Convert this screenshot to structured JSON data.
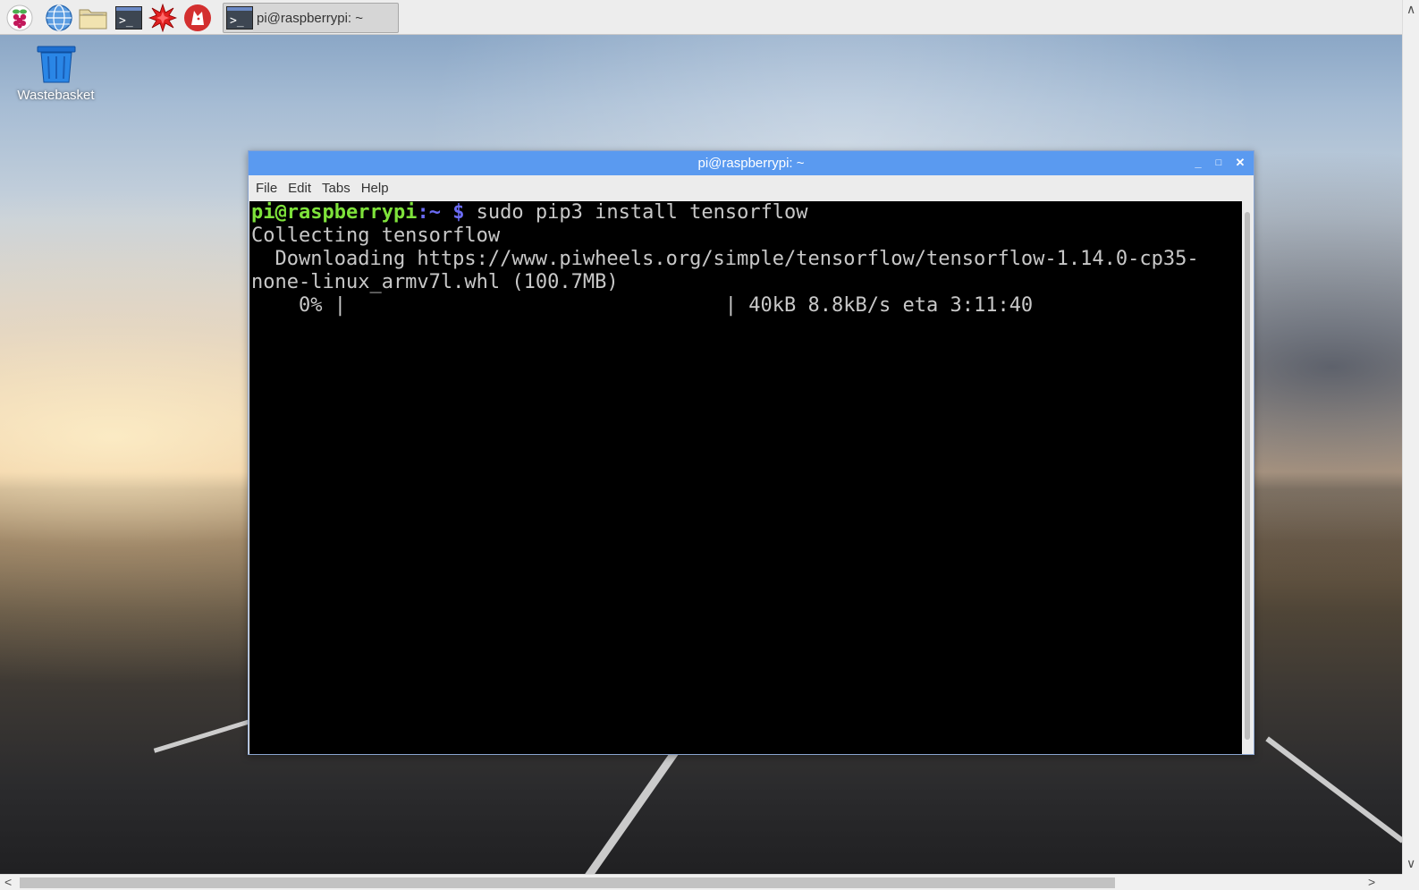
{
  "panel": {
    "launchers": [
      {
        "name": "raspberry-menu",
        "icon": "raspberry-icon"
      },
      {
        "name": "web-browser",
        "icon": "globe-icon"
      },
      {
        "name": "file-manager",
        "icon": "folder-icon"
      },
      {
        "name": "terminal",
        "icon": "terminal-icon"
      },
      {
        "name": "mathematica",
        "icon": "mathematica-icon"
      },
      {
        "name": "wolfram",
        "icon": "wolf-icon"
      }
    ],
    "task": {
      "label": "pi@raspberrypi: ~",
      "icon": "terminal-icon"
    },
    "terminal_glyph": ">_"
  },
  "desktop": {
    "wastebasket_label": "Wastebasket"
  },
  "window": {
    "title": "pi@raspberrypi: ~",
    "controls": {
      "minimize": "_",
      "maximize": "□",
      "close": "✕"
    },
    "menu": [
      {
        "label": "File"
      },
      {
        "label": "Edit"
      },
      {
        "label": "Tabs"
      },
      {
        "label": "Help"
      }
    ],
    "terminal": {
      "prompt_user": "pi@raspberrypi",
      "prompt_sep": ":",
      "prompt_path": "~",
      "prompt_dollar": "$",
      "command": " sudo pip3 install tensorflow",
      "lines": [
        "Collecting tensorflow",
        "  Downloading https://www.piwheels.org/simple/tensorflow/tensorflow-1.14.0-cp35-",
        "none-linux_armv7l.whl (100.7MB)",
        "    0% |                                | 40kB 8.8kB/s eta 3:11:40"
      ]
    }
  },
  "colors": {
    "titlebar": "#5a9af0",
    "prompt_user": "#7ee23a",
    "prompt_path": "#6b6bf5",
    "terminal_bg": "#000000",
    "terminal_fg": "#c8c8c8"
  },
  "scroll_arrows": {
    "up": "∧",
    "down": "∨",
    "left": "<",
    "right": ">"
  }
}
